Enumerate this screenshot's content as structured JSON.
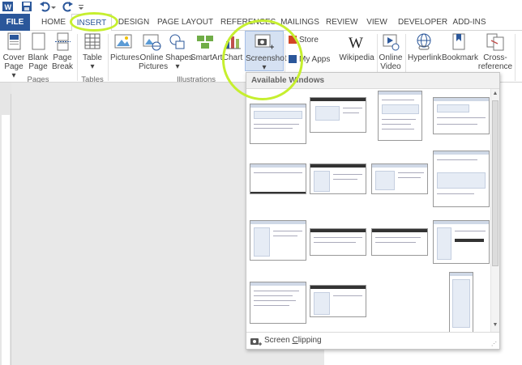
{
  "qat": {
    "icons": [
      "word-app-icon",
      "save-icon",
      "undo-icon",
      "redo-icon",
      "customize-qat-icon"
    ]
  },
  "tabs": [
    {
      "label": "FILE",
      "key": "file"
    },
    {
      "label": "HOME",
      "key": "home"
    },
    {
      "label": "INSERT",
      "key": "insert",
      "active": true
    },
    {
      "label": "DESIGN",
      "key": "design"
    },
    {
      "label": "PAGE LAYOUT",
      "key": "page-layout"
    },
    {
      "label": "REFERENCES",
      "key": "references"
    },
    {
      "label": "MAILINGS",
      "key": "mailings"
    },
    {
      "label": "REVIEW",
      "key": "review"
    },
    {
      "label": "VIEW",
      "key": "view"
    },
    {
      "label": "DEVELOPER",
      "key": "developer"
    },
    {
      "label": "ADD-INS",
      "key": "add-ins"
    }
  ],
  "ribbon": {
    "pages": {
      "cover_page_1": "Cover",
      "cover_page_2": "Page ▾",
      "blank_page_1": "Blank",
      "blank_page_2": "Page",
      "page_break_1": "Page",
      "page_break_2": "Break",
      "group": "Pages"
    },
    "tables": {
      "table_1": "Table",
      "table_2": "▾",
      "group": "Tables"
    },
    "illustrations": {
      "pictures": "Pictures",
      "online_pictures_1": "Online",
      "online_pictures_2": "Pictures",
      "shapes_1": "Shapes",
      "shapes_2": "▾",
      "smartart": "SmartArt",
      "chart": "Chart",
      "screenshot_1": "Screenshot",
      "screenshot_2": "▾",
      "group": "Illustrations"
    },
    "apps": {
      "store": "Store",
      "my_apps": "My Apps",
      "wikipedia": "Wikipedia"
    },
    "media": {
      "online_video_1": "Online",
      "online_video_2": "Video"
    },
    "links": {
      "hyperlink": "Hyperlink",
      "bookmark": "Bookmark",
      "cross_reference_1": "Cross-",
      "cross_reference_2": "reference"
    }
  },
  "screenshot_menu": {
    "header": "Available Windows",
    "windows_count": 15,
    "clipping_prefix": "Screen ",
    "clipping_underlined": "C",
    "clipping_suffix": "lipping"
  },
  "colors": {
    "file_tab": "#2b579a",
    "highlight": "#c6ef2f"
  }
}
